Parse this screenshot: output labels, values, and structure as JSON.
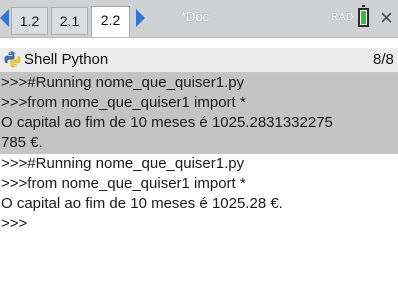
{
  "tabs": [
    {
      "label": "1.2",
      "active": false
    },
    {
      "label": "2.1",
      "active": false
    },
    {
      "label": "2.2",
      "active": true
    }
  ],
  "document_name": "*Doc",
  "angle_mode": "RAD",
  "app": {
    "title": "Shell Python",
    "page_indicator": "8/8"
  },
  "shell": {
    "highlighted_lines": [
      ">>>#Running nome_que_quiser1.py",
      ">>>from nome_que_quiser1 import *",
      "O capital ao fim de 10 meses é 1025.2831332275",
      "785 €."
    ],
    "lines": [
      ">>>#Running nome_que_quiser1.py",
      ">>>from nome_que_quiser1 import *",
      "O capital ao fim de 10 meses é 1025.28 €.",
      ">>>"
    ]
  },
  "colors": {
    "accent_blue": "#2e76d6",
    "battery_green": "#2fc12f",
    "highlight_gray": "#c4c4c4"
  },
  "icons": {
    "nav_left": "triangle-left-icon",
    "nav_right": "triangle-right-icon",
    "battery": "battery-icon",
    "close": "close-icon",
    "app": "python-logo-icon"
  }
}
